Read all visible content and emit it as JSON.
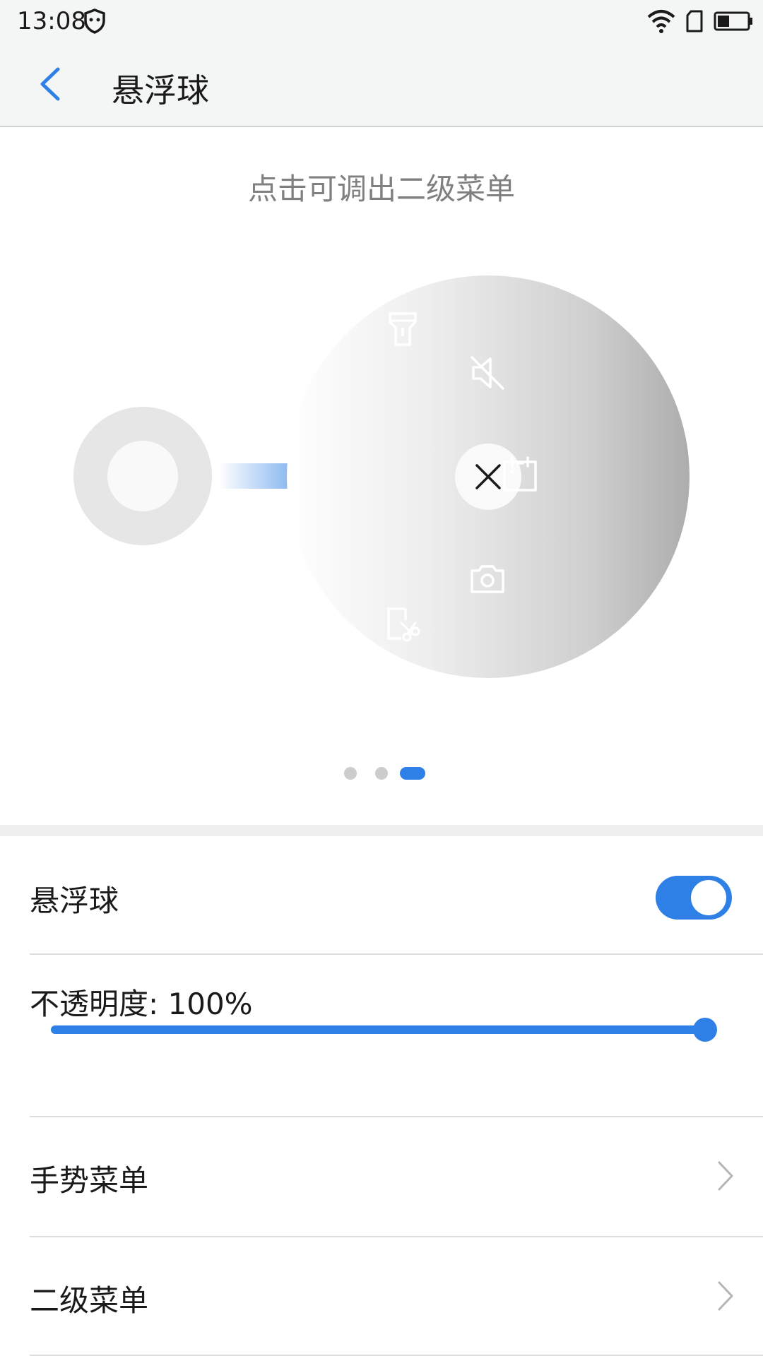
{
  "status_bar": {
    "time": "13:08"
  },
  "header": {
    "title": "悬浮球"
  },
  "illustration": {
    "hint": "点击可调出二级菜单",
    "menu_icons": [
      "flashlight-icon",
      "mute-icon",
      "calendar-icon",
      "camera-icon",
      "screenshot-crop-icon"
    ]
  },
  "pager": {
    "count": 3,
    "active_index": 2
  },
  "settings": {
    "floating_ball": {
      "label": "悬浮球",
      "enabled": true
    },
    "opacity": {
      "label": "不透明度: 100%",
      "value_percent": 100
    },
    "gesture_menu": {
      "label": "手势菜单"
    },
    "secondary_menu": {
      "label": "二级菜单"
    }
  },
  "colors": {
    "accent": "#2f80e6"
  }
}
